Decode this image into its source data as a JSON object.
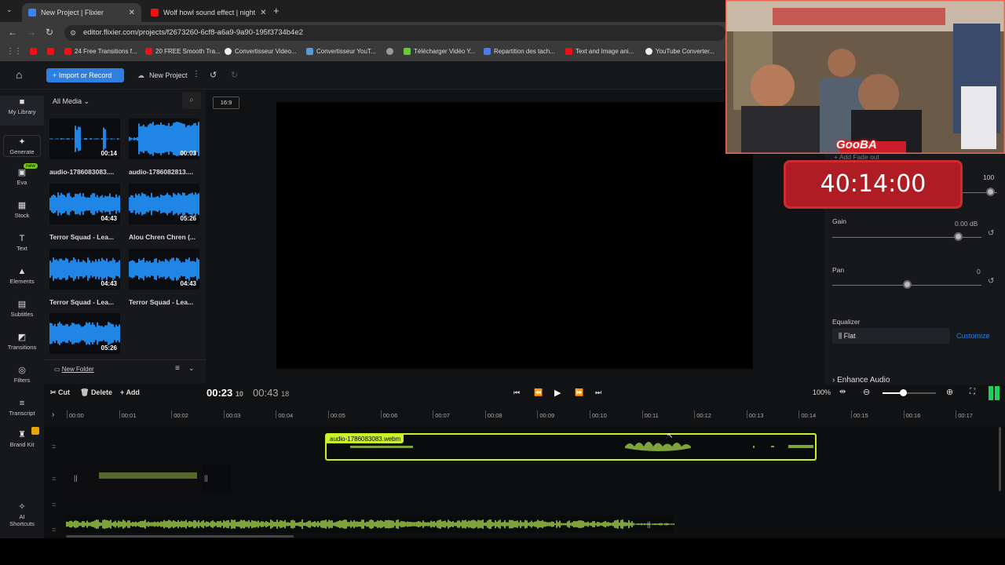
{
  "browser": {
    "tabs": [
      {
        "title": "New Project | Flixier",
        "active": true
      },
      {
        "title": "Wolf howl sound effect | night",
        "active": false
      }
    ],
    "url": "editor.flixier.com/projects/f2673260-6cf8-a6a9-9a90-195f3734b4e2",
    "bookmarks": [
      "24 Free Transitions f...",
      "20 FREE Smooth Tra...",
      "Convertisseur Video...",
      "Convertisseur YouT...",
      "Télécharger Vidéo Y...",
      "Repartition des tach...",
      "Text and Image ani...",
      "YouTube Converter..."
    ]
  },
  "topbar": {
    "import_label": "Import or Record",
    "project_label": "New Project"
  },
  "sidebar": {
    "items": [
      {
        "label": "My Library",
        "icon": "folder-icon"
      },
      {
        "label": "Generate",
        "icon": "sparkle-icon"
      },
      {
        "label": "Eva",
        "icon": "robot-icon",
        "badge": "new"
      },
      {
        "label": "Stock",
        "icon": "grid-icon"
      },
      {
        "label": "Text",
        "icon": "text-icon"
      },
      {
        "label": "Elements",
        "icon": "shapes-icon"
      },
      {
        "label": "Subtitles",
        "icon": "subtitles-icon"
      },
      {
        "label": "Transitions",
        "icon": "transitions-icon"
      },
      {
        "label": "Filters",
        "icon": "filters-icon"
      },
      {
        "label": "Transcript",
        "icon": "transcript-icon"
      },
      {
        "label": "Brand Kit",
        "icon": "brandkit-icon"
      },
      {
        "label": "AI Shortcuts",
        "icon": "ai-icon"
      }
    ]
  },
  "library": {
    "filter_label": "All Media",
    "new_folder_label": "New Folder",
    "items": [
      {
        "name": "audio-1786083083....",
        "duration": "00:14"
      },
      {
        "name": "audio-1786082813....",
        "duration": "00:03"
      },
      {
        "name": "Terror Squad - Lea...",
        "duration": "04:43"
      },
      {
        "name": "Alou Chren Chren (...",
        "duration": "05:26"
      },
      {
        "name": "Terror Squad - Lea...",
        "duration": "04:43"
      },
      {
        "name": "Terror Squad - Lea...",
        "duration": "04:43"
      },
      {
        "name": "",
        "duration": "05:26"
      }
    ]
  },
  "preview": {
    "aspect_label": "16:9"
  },
  "audio_panel": {
    "volume_value": "100",
    "gain_label": "Gain",
    "gain_value": "0.00 dB",
    "pan_label": "Pan",
    "pan_value": "0",
    "equalizer_label": "Equalizer",
    "equalizer_preset": "Flat",
    "customize_label": "Customize",
    "enhance_label": "Enhance Audio",
    "add_fade_label": "+ Add Fade out"
  },
  "timeline": {
    "cut_label": "Cut",
    "delete_label": "Delete",
    "add_label": "Add",
    "current_time": "00:23",
    "current_frame": "10",
    "total_time": "00:43",
    "total_frame": "18",
    "zoom_label": "100%",
    "ticks": [
      "00:00",
      "00:01",
      "00:02",
      "00:03",
      "00:04",
      "00:05",
      "00:06",
      "00:07",
      "00:08",
      "00:09",
      "00:10",
      "00:11",
      "00:12",
      "00:13",
      "00:14",
      "00:15",
      "00:16",
      "00:17"
    ],
    "clip_label": "audio-1786083083.webm"
  },
  "overlay": {
    "timer": "40:14:00",
    "channel_name": "GooBA"
  },
  "colors": {
    "accent_blue": "#2f7fe0",
    "waveform_blue": "#1f86e6",
    "waveform_green": "#7da33a",
    "clip_border": "#c9f22b"
  }
}
